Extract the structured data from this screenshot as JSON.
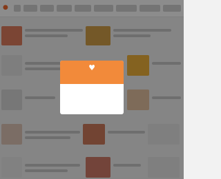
{
  "site": {
    "logo_glyph": "●"
  },
  "colors": {
    "accent": "#f28a3a",
    "overlay": "rgba(0,0,0,0.45)"
  },
  "modal": {
    "icon": "heart-icon",
    "icon_glyph": "♥",
    "title": "",
    "subtitle": "",
    "body": ""
  }
}
